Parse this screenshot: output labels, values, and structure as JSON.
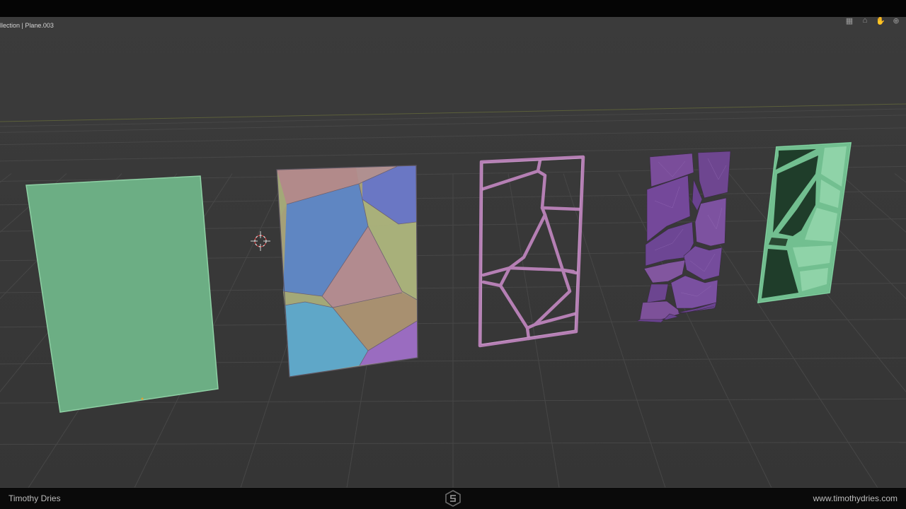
{
  "viewport": {
    "header_text_collection": "llection",
    "header_text_separator": " | ",
    "header_text_object": "Plane.003",
    "objects": [
      {
        "name": "Plane",
        "style": "solid",
        "color": "#6cae84"
      },
      {
        "name": "Voronoi Colored Plane",
        "style": "voronoi-cells",
        "colors": [
          "#b28a8a",
          "#6a77c4",
          "#5f86c2",
          "#a9b07a",
          "#b28b8f",
          "#a5a078",
          "#5fa7c8",
          "#9a6cc0",
          "#a3a878"
        ]
      },
      {
        "name": "Voronoi Frame",
        "style": "wire-frame",
        "color": "#b57fb4"
      },
      {
        "name": "Voronoi Shards",
        "style": "faceted-shards",
        "color": "#7a4d9a"
      },
      {
        "name": "Stained Glass Panel",
        "style": "glass-panel",
        "colors": [
          "#8fd3a8",
          "#1f3d2a"
        ]
      }
    ],
    "cursor": "3d-cursor-icon",
    "gizmos": [
      {
        "name": "grid-view-icon",
        "glyph": "▦"
      },
      {
        "name": "camera-icon",
        "glyph": "⌂"
      },
      {
        "name": "hand-pan-icon",
        "glyph": "✋"
      },
      {
        "name": "zoom-icon",
        "glyph": "⊕"
      }
    ]
  },
  "footer": {
    "author": "Timothy Dries",
    "website": "www.timothydries.com",
    "logo": "studio-logo-icon"
  }
}
